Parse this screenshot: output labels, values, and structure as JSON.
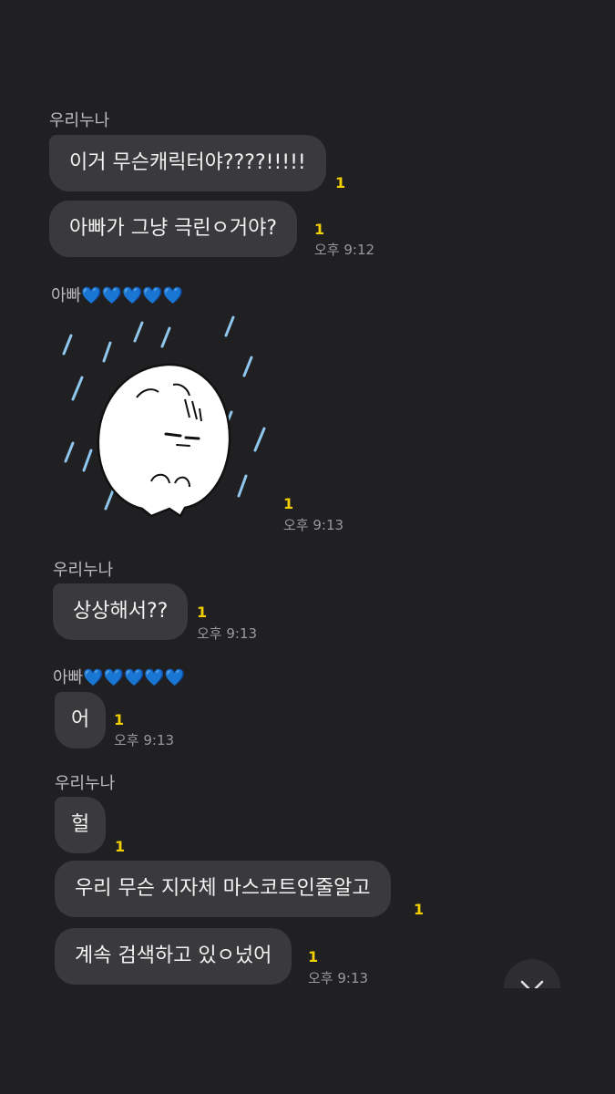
{
  "chat": {
    "sender_a": "우리누나",
    "sender_b_name": "아빠",
    "heart_icons": [
      "blue-heart-icon",
      "blue-heart-icon",
      "blue-heart-icon",
      "blue-heart-icon",
      "blue-heart-icon"
    ],
    "heart_glyph": "💙",
    "unread_count": "1",
    "messages": {
      "m1": "이거 무슨캐릭터야????!!!!!",
      "m2": "아빠가 그냥 극린ㅇ거야?",
      "m3": "상상해서??",
      "m4": "어",
      "m5": "헐",
      "m6": "우리 무슨 지자체 마스코트인줄알고",
      "m7": "계속 검색하고 있ㅇ넜어"
    },
    "times": {
      "t1": "오후 9:12",
      "t2": "오후 9:13",
      "t3": "오후 9:13",
      "t4": "오후 9:13",
      "t5": "오후 9:13"
    },
    "sticker": {
      "icon": "crying-white-fluffy-character-sticker"
    },
    "scroll_button": {
      "icon": "chevron-down-icon"
    }
  },
  "colors": {
    "background": "#202023",
    "bubble": "#3a3a3d",
    "unread": "#f2cf00",
    "time": "#9a9a9d",
    "heart": "#2f8bff",
    "rain": "#8fc7ee"
  }
}
